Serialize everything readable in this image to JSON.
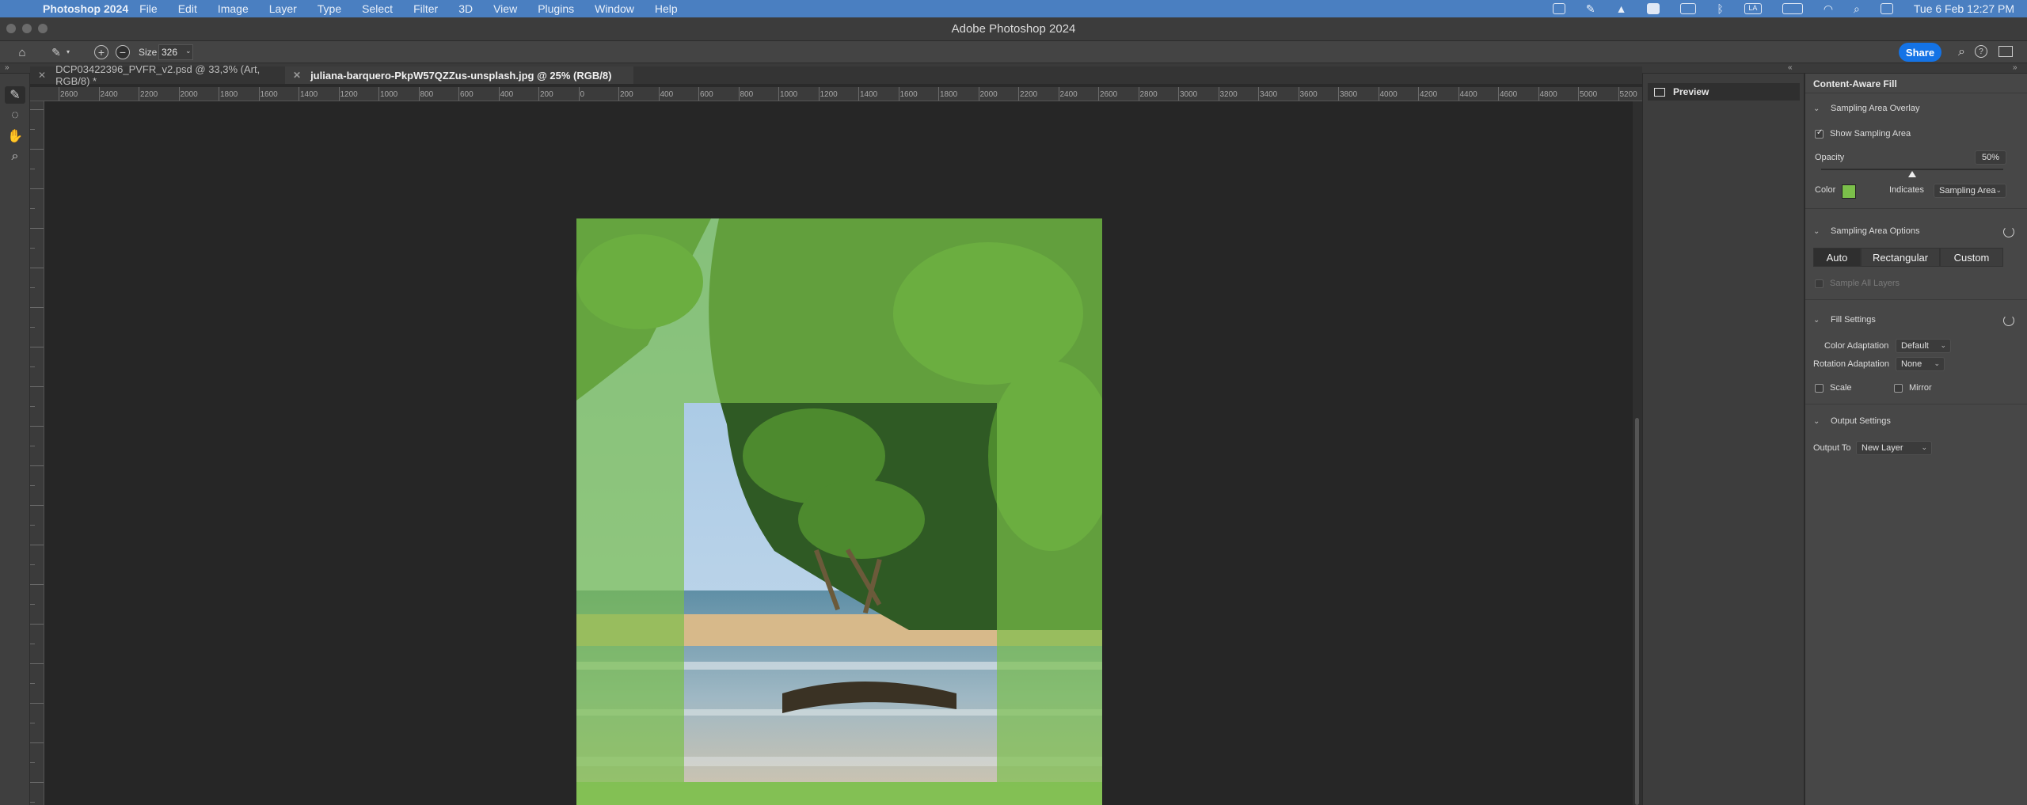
{
  "menubar": {
    "app_name": "Photoshop 2024",
    "items": [
      "File",
      "Edit",
      "Image",
      "Layer",
      "Type",
      "Select",
      "Filter",
      "3D",
      "View",
      "Plugins",
      "Window",
      "Help"
    ],
    "datetime": "Tue 6 Feb  12:27 PM",
    "status_icons": [
      "dropbox-icon",
      "pen-icon",
      "drive-icon",
      "bold-icon",
      "cloud-icon",
      "bluetooth-icon",
      "input-la-icon",
      "battery-icon",
      "wifi-icon",
      "search-icon",
      "control-center-icon"
    ],
    "input_source": "LA"
  },
  "window": {
    "title": "Adobe Photoshop 2024"
  },
  "options_bar": {
    "size_label": "Size",
    "size_value": "326",
    "share_label": "Share"
  },
  "tabs": [
    {
      "label": "DCP03422396_PVFR_v2.psd @ 33,3% (Art, RGB/8) *",
      "active": false
    },
    {
      "label": "juliana-barquero-PkpW57QZZus-unsplash.jpg @ 25% (RGB/8)",
      "active": true
    }
  ],
  "ruler": {
    "h_labels": [
      "2600",
      "2400",
      "2200",
      "2000",
      "1800",
      "1600",
      "1400",
      "1200",
      "1000",
      "800",
      "600",
      "400",
      "200",
      "0",
      "200",
      "400",
      "600",
      "800",
      "1000",
      "1200",
      "1400",
      "1600",
      "1800",
      "2000",
      "2200",
      "2400",
      "2600",
      "2800",
      "3000",
      "3200",
      "3400",
      "3600",
      "3800",
      "4000",
      "4200",
      "4400",
      "4600",
      "4800",
      "5000",
      "5200"
    ]
  },
  "preview": {
    "label": "Preview"
  },
  "panel": {
    "title": "Content-Aware Fill",
    "overlay": {
      "header": "Sampling Area Overlay",
      "show_label": "Show Sampling Area",
      "show_checked": true,
      "opacity_label": "Opacity",
      "opacity_value": "50%",
      "opacity_fraction": 0.5,
      "color_label": "Color",
      "color_value": "#7bbf4a",
      "indicates_label": "Indicates",
      "indicates_value": "Sampling Area"
    },
    "sampling": {
      "header": "Sampling Area Options",
      "buttons": [
        "Auto",
        "Rectangular",
        "Custom"
      ],
      "selected": "Auto",
      "sample_all_label": "Sample All Layers"
    },
    "fill": {
      "header": "Fill Settings",
      "color_adapt_label": "Color Adaptation",
      "color_adapt_value": "Default",
      "rotation_label": "Rotation Adaptation",
      "rotation_value": "None",
      "scale_label": "Scale",
      "mirror_label": "Mirror"
    },
    "output": {
      "header": "Output Settings",
      "output_label": "Output To",
      "output_value": "New Layer"
    }
  },
  "colors": {
    "menubar_bg": "#4a7fc1",
    "share_blue": "#1473e6",
    "overlay_green": "#7bbf4a"
  }
}
